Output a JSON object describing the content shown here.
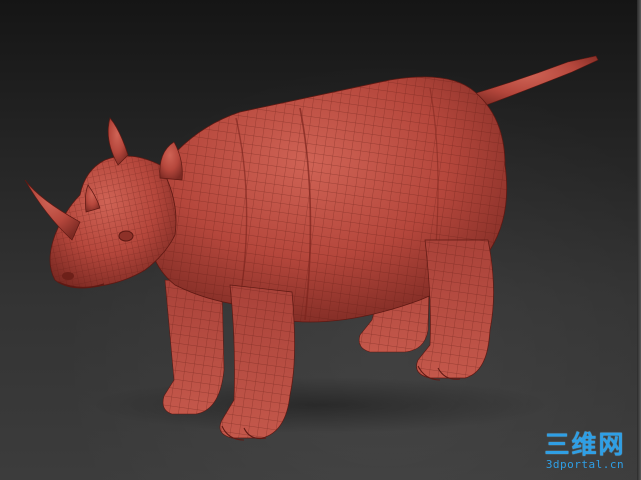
{
  "viewport": {
    "background_top": "#151515",
    "background_bottom": "#3c3c3c"
  },
  "model": {
    "icon": "rhino-sculpt-model",
    "material_color": "#b5473c",
    "wire_color": "#5e1913"
  },
  "watermark": {
    "cn_text": "三维网",
    "en_text": "3dportal.cn",
    "color": "#2e9fe6"
  }
}
